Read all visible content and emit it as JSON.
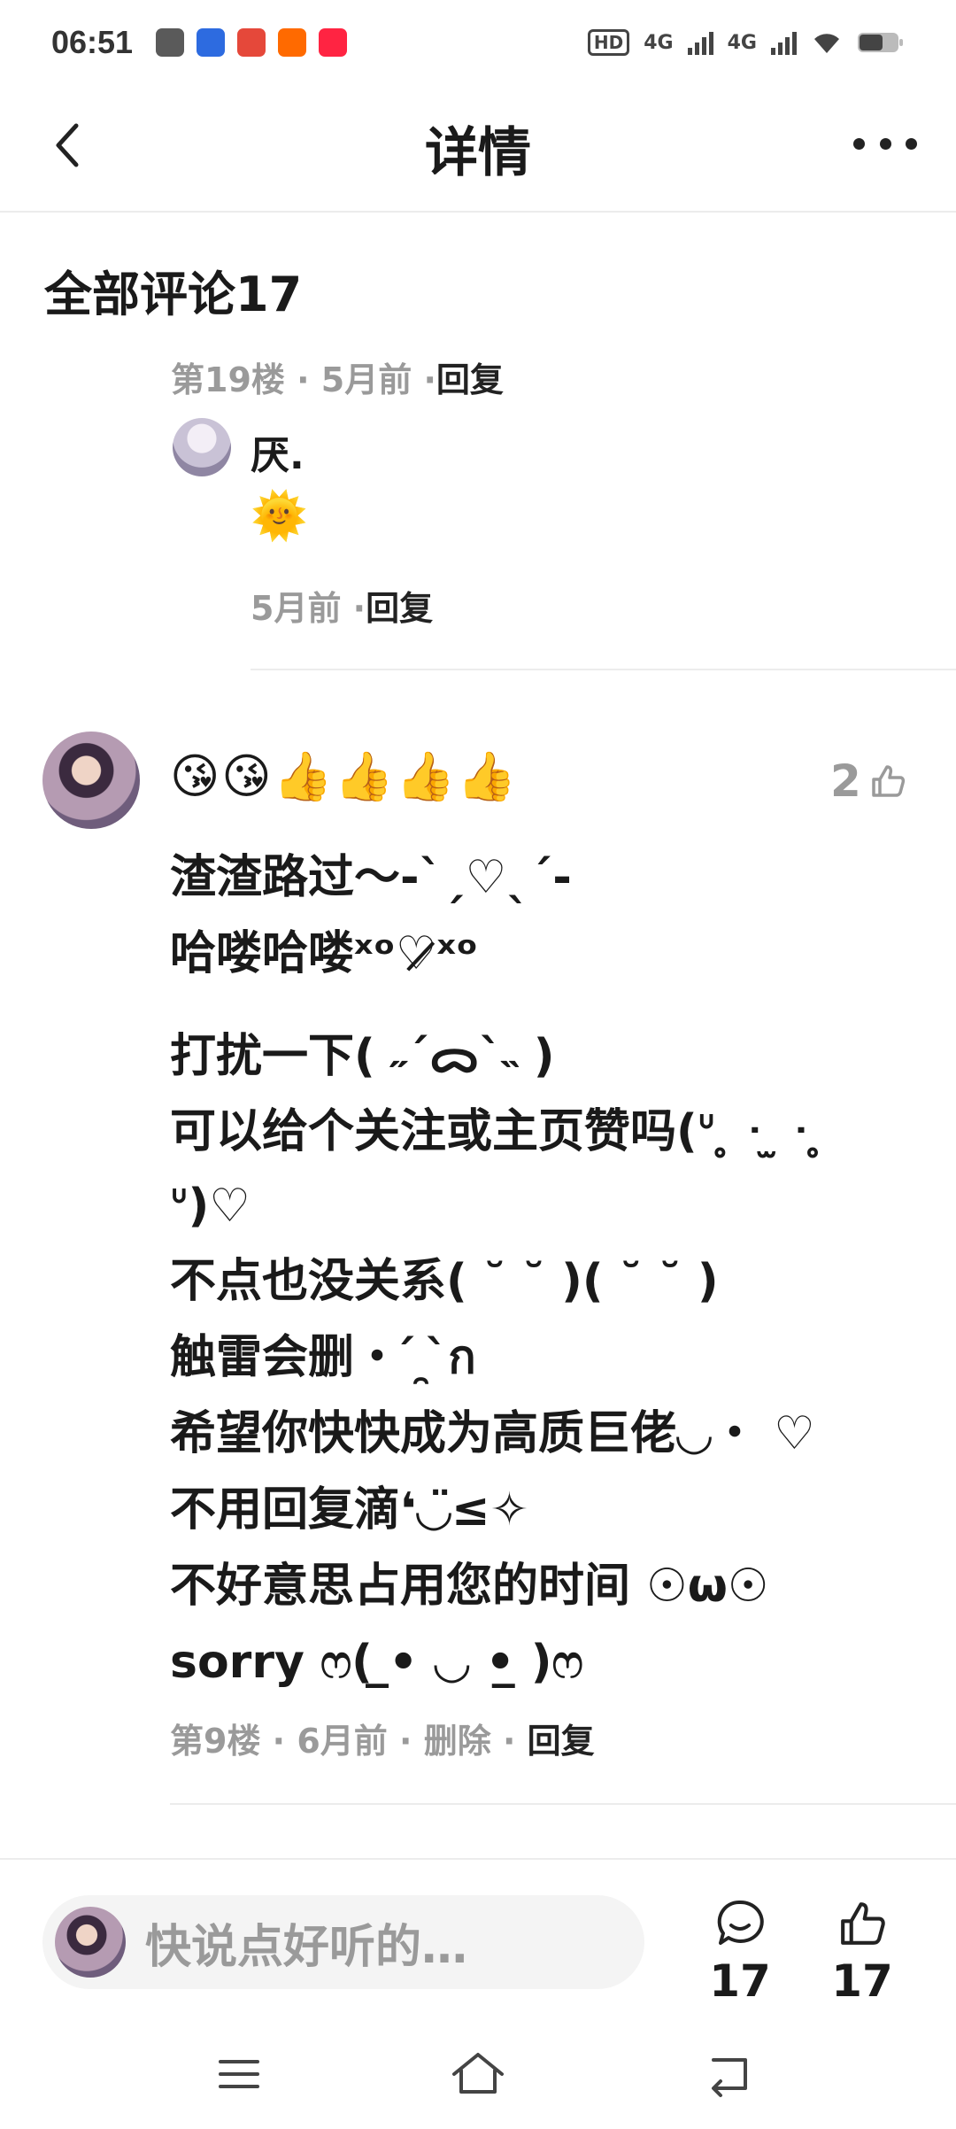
{
  "status_bar": {
    "time": "06:51",
    "hd_label": "HD",
    "signal_1": "4G",
    "signal_2": "4G",
    "notification_icons": [
      "wechat-icon",
      "baidu-icon",
      "travel-icon",
      "taobao-icon",
      "xiaohongshu-icon"
    ],
    "notification_colors": [
      "#5a5a5a",
      "#2d6be0",
      "#e5483a",
      "#ff6a00",
      "#ff2442"
    ]
  },
  "header": {
    "title": "详情",
    "back_icon": "chevron-left-icon",
    "more_icon": "more-dots-icon"
  },
  "comments_section": {
    "title": "全部评论17",
    "floor_reply": {
      "floor": "第19楼",
      "time": "5月前",
      "reply_label": "回复"
    },
    "reply": {
      "author": "厌.",
      "content": "🌞",
      "time": "5月前",
      "reply_label": "回复"
    },
    "main_comment": {
      "emojis": "😘😘👍👍👍👍",
      "like_count": "2",
      "lines": [
        "渣渣路过～-ˋˏ♡ˎˊ-",
        "哈喽哈喽ˣᵒ♡̷̷̷̷ˣᵒ",
        "打扰一下( ˶ˊᯅˋ˵ )",
        "可以给个关注或主页赞吗(ᐡ ̥ ᐧ ̫ ᐧ ̥ ᐡ)♡",
        "不点也没关系( ˘ ˘ )( ˘ ˘ )",
        "触雷会删・ ́ ̯ ̀ก",
        "希望你快快成为高质巨佬◡・ ♡",
        "不用回复滴❛◡̈≤✧",
        "不好意思占用您的时间 ☉ω☉",
        "sorry ෆ( ̲• ◡ •̲ )ෆ"
      ],
      "floor": "第9楼",
      "time": "6月前",
      "delete_label": "删除",
      "reply_label": "回复"
    }
  },
  "bottom_bar": {
    "input_placeholder": "快说点好听的…",
    "comment_count": "17",
    "like_count": "17"
  },
  "nav_bar": {
    "menu_icon": "menu-icon",
    "home_icon": "home-icon",
    "back_icon": "back-icon"
  },
  "colors": {
    "text_primary": "#1a1a1a",
    "text_secondary": "#9a9a9a",
    "divider": "#ececec",
    "input_bg": "#f4f4f4"
  }
}
